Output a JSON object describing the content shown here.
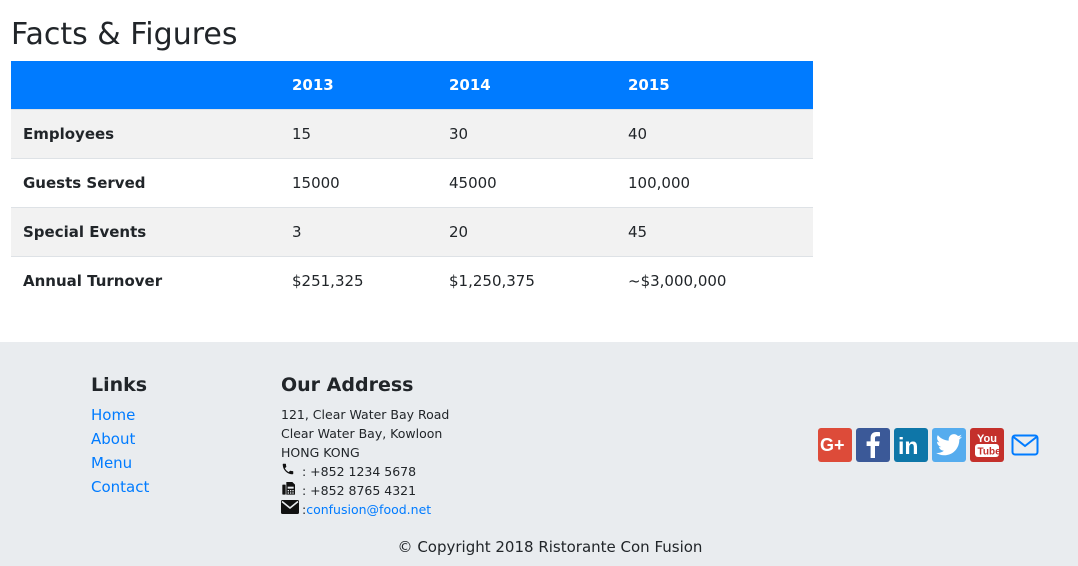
{
  "page": {
    "title": "Facts & Figures"
  },
  "table": {
    "headers": [
      "",
      "2013",
      "2014",
      "2015"
    ],
    "rows": [
      {
        "label": "Employees",
        "values": [
          "15",
          "30",
          "40"
        ]
      },
      {
        "label": "Guests Served",
        "values": [
          "15000",
          "45000",
          "100,000"
        ]
      },
      {
        "label": "Special Events",
        "values": [
          "3",
          "20",
          "45"
        ]
      },
      {
        "label": "Annual Turnover",
        "values": [
          "$251,325",
          "$1,250,375",
          "~$3,000,000"
        ]
      }
    ]
  },
  "footer": {
    "links_heading": "Links",
    "links": [
      "Home",
      "About",
      "Menu",
      "Contact"
    ],
    "address_heading": "Our Address",
    "address_lines": [
      "121, Clear Water Bay Road",
      "Clear Water Bay, Kowloon",
      "HONG KONG"
    ],
    "phone": ": +852 1234 5678",
    "fax": ": +852 8765 4321",
    "email_prefix": ": ",
    "email": "confusion@food.net",
    "social": [
      {
        "icon": "google-plus-icon",
        "color": "#dd4b39"
      },
      {
        "icon": "facebook-icon",
        "color": "#3b5998"
      },
      {
        "icon": "linkedin-icon",
        "color": "#0e76a8"
      },
      {
        "icon": "twitter-icon",
        "color": "#55acee"
      },
      {
        "icon": "youtube-icon",
        "color": "#c4302b"
      },
      {
        "icon": "mail-icon",
        "color": "#007bff"
      }
    ],
    "copyright": "© Copyright 2018 Ristorante Con Fusion"
  },
  "colors": {
    "accent": "#007bff",
    "footer_bg": "#e9ecef",
    "stripe": "#f2f2f2"
  }
}
